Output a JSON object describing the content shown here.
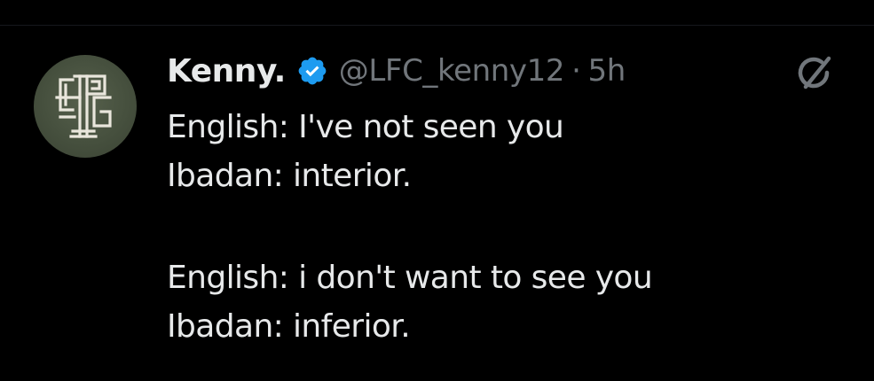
{
  "tweet": {
    "author": {
      "display_name": "Kenny.",
      "handle": "@LFC_kenny12",
      "verified": true,
      "avatar_icon": "monogram-logo-icon"
    },
    "separator": "·",
    "timestamp": "5h",
    "lines": [
      "English: I've not seen you",
      "Ibadan: interior.",
      "English: i don't want to see you",
      "Ibadan: inferior."
    ]
  },
  "icons": {
    "verified": "verified-badge-icon",
    "grok": "grok-icon"
  },
  "colors": {
    "background": "#000000",
    "text_primary": "#e7e9ea",
    "text_secondary": "#71767b",
    "verified_blue": "#1d9bf0",
    "avatar_bg": "#4a5442"
  }
}
